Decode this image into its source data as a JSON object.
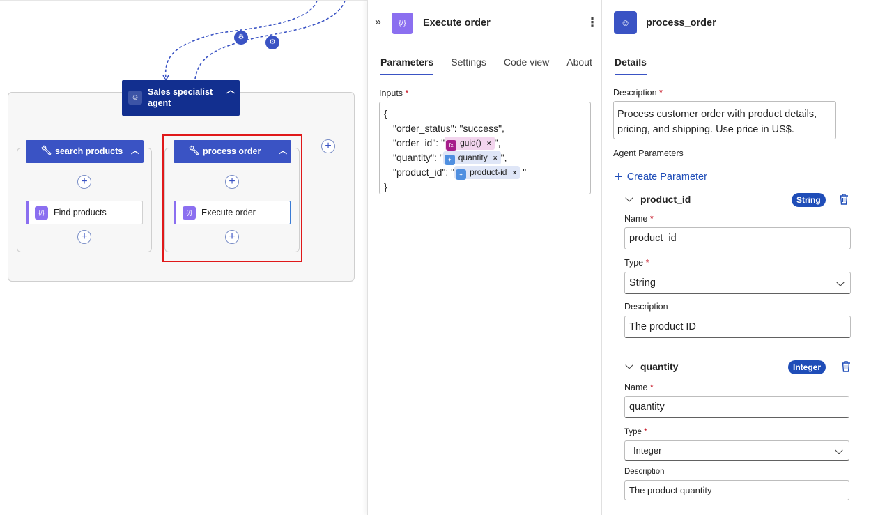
{
  "canvas": {
    "agent": {
      "label": "Sales specialist agent",
      "icon": "robot-icon"
    },
    "tools": [
      {
        "label": "search products",
        "icon": "wrench-icon",
        "action": "Find products"
      },
      {
        "label": "process order",
        "icon": "wrench-icon",
        "action": "Execute order"
      }
    ]
  },
  "action_panel": {
    "title": "Execute order",
    "icon": "code-braces-icon",
    "tabs": [
      "Parameters",
      "Settings",
      "Code view",
      "About"
    ],
    "active_tab": "Parameters",
    "inputs_label": "Inputs",
    "inputs": {
      "open_brace": "{",
      "close_brace": "}",
      "order_status_key": "\"order_status\": ",
      "order_status_value": "\"success\",",
      "order_id_key": "\"order_id\": \"",
      "order_id_token": "guid()",
      "order_id_suffix": "\",",
      "quantity_key": "\"quantity\": \"",
      "quantity_token": "quantity",
      "quantity_suffix": "\",",
      "product_id_key": "\"product_id\": \"",
      "product_id_token": "product-id",
      "product_id_suffix": "\""
    }
  },
  "details_panel": {
    "title": "process_order",
    "icon": "robot-icon",
    "tab": "Details",
    "description_label": "Description",
    "description": "Process customer order with product details, pricing, and shipping. Use price in US$.",
    "agent_parameters_label": "Agent Parameters",
    "create_parameter": "Create Parameter",
    "name_label": "Name",
    "type_label": "Type",
    "param_description_label": "Description",
    "params": [
      {
        "name": "product_id",
        "type_badge": "String",
        "name_value": "product_id",
        "type_value": "String",
        "description": "The product ID"
      },
      {
        "name": "quantity",
        "type_badge": "Integer",
        "name_value": "quantity",
        "type_value": "Integer",
        "description": "The product quantity"
      }
    ]
  },
  "colors": {
    "agent_node": "#122f8f",
    "tool_header": "#3a53c4",
    "action_accent": "#8b6ff0",
    "selection_frame": "#e0191a",
    "badge": "#1f4db8"
  }
}
